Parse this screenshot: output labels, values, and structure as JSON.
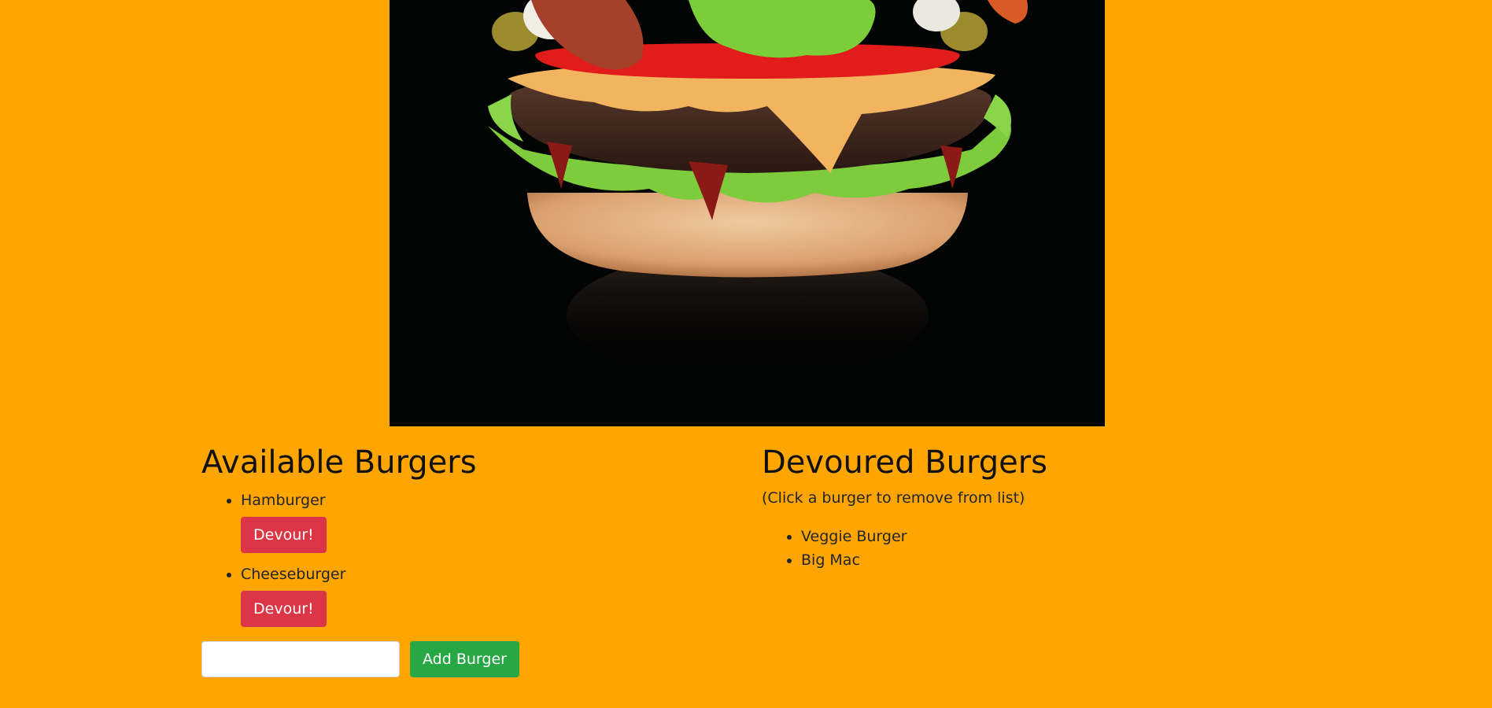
{
  "hero": {
    "image_subject": "cheeseburger with lettuce, tomato, cheese and bacon on black background"
  },
  "available": {
    "heading": "Available Burgers",
    "items": [
      {
        "name": "Hamburger",
        "button_label": "Devour!"
      },
      {
        "name": "Cheeseburger",
        "button_label": "Devour!"
      }
    ]
  },
  "devoured": {
    "heading": "Devoured Burgers",
    "note": "(Click a burger to remove from list)",
    "items": [
      "Veggie Burger",
      "Big Mac"
    ]
  },
  "form": {
    "input_value": "",
    "input_placeholder": "",
    "submit_label": "Add Burger"
  },
  "colors": {
    "background": "#ffa500",
    "danger": "#dc3545",
    "success": "#28a745"
  }
}
